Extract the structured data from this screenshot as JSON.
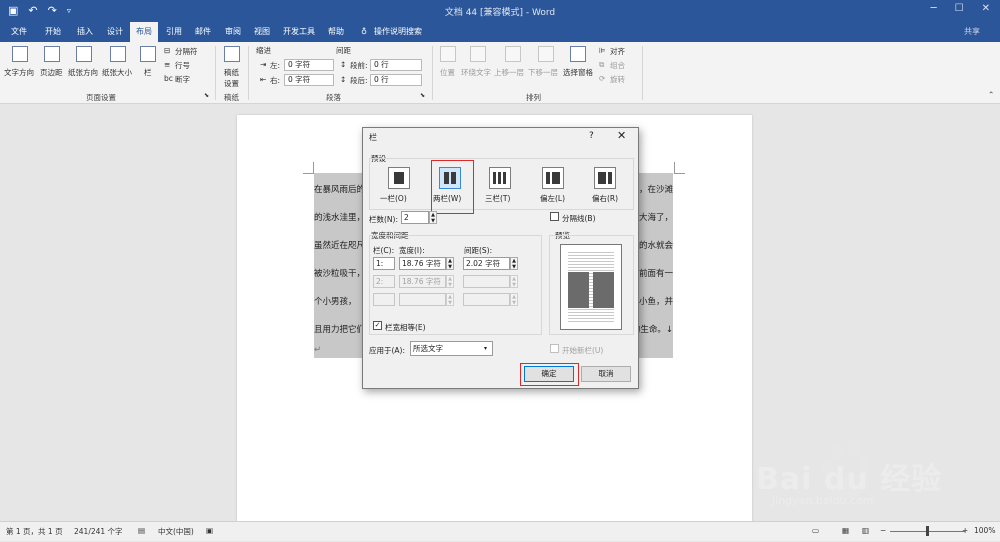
{
  "titlebar": {
    "title": "文档 44 [兼容模式] - Word",
    "qat": {
      "save_icon": "save-icon",
      "undo_icon": "undo-icon",
      "redo_icon": "redo-icon"
    }
  },
  "tabs": [
    "文件",
    "开始",
    "插入",
    "设计",
    "布局",
    "引用",
    "邮件",
    "审阅",
    "视图",
    "开发工具",
    "帮助"
  ],
  "active_tab": "布局",
  "tell_me": "操作说明搜索",
  "share": "共享",
  "ribbon": {
    "page_setup": {
      "text_direction": "文字方向",
      "margins": "页边距",
      "orientation": "纸张方向",
      "size": "纸张大小",
      "columns": "栏",
      "breaks": "分隔符",
      "line_numbers": "行号",
      "hyphenation": "断字",
      "group_label": "页面设置"
    },
    "draft": {
      "button": "稿纸设置",
      "group_label": "稿纸"
    },
    "paragraph": {
      "indent_label": "缩进",
      "spacing_label": "间距",
      "left_label": "左:",
      "right_label": "右:",
      "left_value": "0 字符",
      "right_value": "0 字符",
      "before_label": "段前:",
      "after_label": "段后:",
      "before_value": "0 行",
      "after_value": "0 行",
      "group_label": "段落"
    },
    "arrange": {
      "position": "位置",
      "wrap_text": "环绕文字",
      "bring_forward": "上移一层",
      "send_backward": "下移一层",
      "selection_pane": "选择窗格",
      "align": "对齐",
      "group": "组合",
      "rotate": "旋转",
      "group_label": "排列"
    }
  },
  "document": {
    "left_lines": [
      "在暴风雨后的",
      "的浅水洼里，",
      "虽然近在咫尺",
      "被沙粒吸干，",
      "个小男孩，",
      "且用力把它们"
    ],
    "right_lines": [
      "，在沙滩",
      "大海了，",
      "的水就会",
      "前面有一",
      "小鱼，并",
      "门的生命。↓"
    ],
    "trailing_mark": "↵"
  },
  "dialog": {
    "title": "栏",
    "help": "?",
    "close": "✕",
    "presets_label": "预设",
    "presets": [
      {
        "label": "一栏(O)",
        "name": "one"
      },
      {
        "label": "两栏(W)",
        "name": "two"
      },
      {
        "label": "三栏(T)",
        "name": "three"
      },
      {
        "label": "偏左(L)",
        "name": "left"
      },
      {
        "label": "偏右(R)",
        "name": "right"
      }
    ],
    "selected_preset": "两栏(W)",
    "num_columns_label": "栏数(N):",
    "num_columns_value": "2",
    "line_between_label": "分隔线(B)",
    "width_spacing_label": "宽度和间距",
    "preview_label": "预览",
    "col_header": "栏(C):",
    "width_header": "宽度(I):",
    "spacing_header": "间距(S):",
    "rows": [
      {
        "num": "1:",
        "width": "18.76 字符",
        "spacing": "2.02 字符",
        "enabled": true
      },
      {
        "num": "2:",
        "width": "18.76 字符",
        "spacing": "",
        "enabled": false
      },
      {
        "num": "",
        "width": "",
        "spacing": "",
        "enabled": false
      }
    ],
    "equal_width_label": "栏宽相等(E)",
    "equal_width_checked": "✓",
    "apply_to_label": "应用于(A):",
    "apply_to_value": "所选文字",
    "start_new_column_label": "开始新栏(U)",
    "ok": "确定",
    "cancel": "取消"
  },
  "statusbar": {
    "page": "第 1 页，共 1 页",
    "words": "241/241 个字",
    "language": "中文(中国)",
    "zoom": "100%",
    "zoom_out": "−",
    "zoom_in": "+"
  },
  "watermark": {
    "brand": "Bai du 经验",
    "url": "jingyan.baidu.com"
  },
  "colors": {
    "brand": "#2b579a",
    "highlight": "#e02828",
    "accent": "#0078d7"
  }
}
